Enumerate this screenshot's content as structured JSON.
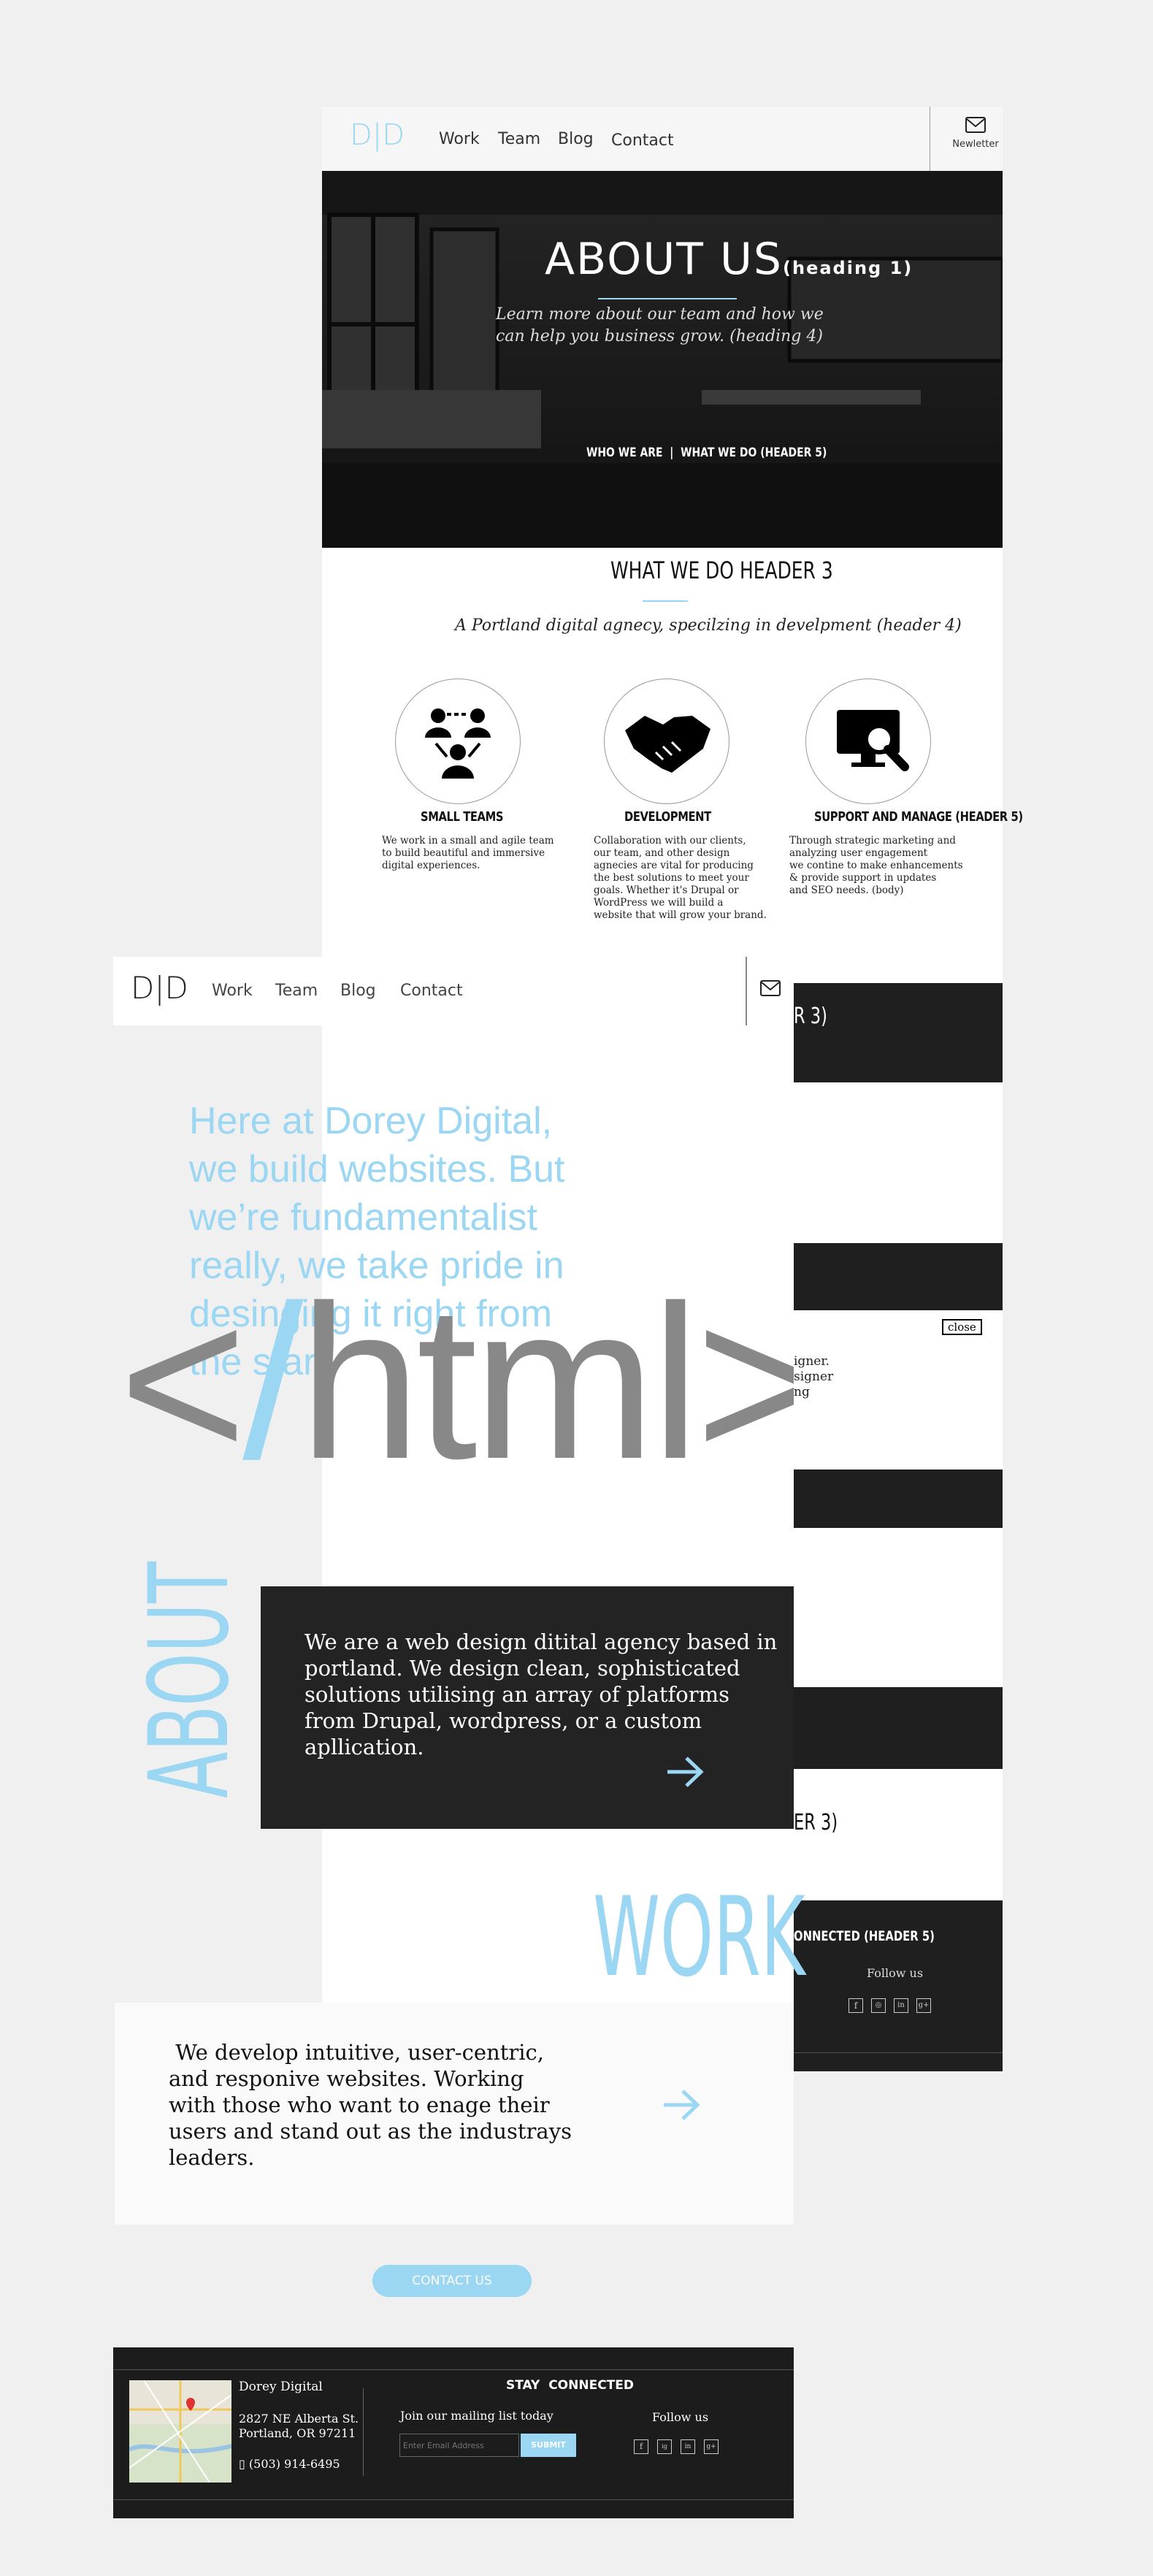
{
  "colors": {
    "accent": "#9bd6f2",
    "dark": "#222222",
    "page": "#f0f0f0"
  },
  "back": {
    "logo": "D|D",
    "nav": [
      "Work",
      "Team",
      "Blog",
      "Contact"
    ],
    "newsletter_label": "Newletter",
    "hero": {
      "title": "ABOUT US",
      "title_suffix": "(heading 1)",
      "subtitle_line1": "Learn more about our team and how we",
      "subtitle_line2": "can help you business grow. (heading 4)",
      "link_who": "WHO WE ARE",
      "link_sep": "|",
      "link_what": "WHAT WE DO (HEADER 5)"
    },
    "what_we_do": {
      "title": "WHAT WE DO HEADER 3",
      "subtitle": "A Portland digital agnecy, specilzing in develpment (header 4)"
    },
    "services": [
      {
        "icon": "team-icon",
        "title": "SMALL TEAMS",
        "body": "We work in a small and agile team\nto build beautiful and immersive\ndigital experiences."
      },
      {
        "icon": "handshake-icon",
        "title": "DEVELOPMENT",
        "body": "Collaboration with our clients,\nour team, and other design\nagnecies are vital for producing\n the best solutions to meet your\ngoals. Whether it's Drupal or\nWordPress we will build a\nwebsite that will grow your brand."
      },
      {
        "icon": "monitor-search-icon",
        "title": "SUPPORT AND MANAGE (HEADER 5)",
        "body": "Through strategic marketing and\n analyzing user engagement\nwe contine to make enhancements\n& provide support in updates\nand SEO needs. (body)"
      }
    ],
    "partial_heading_1": "R 3)",
    "close_label": "close",
    "partial_text": "igner.\nsigner\nng",
    "partial_heading_2": "ER 3)",
    "footer_partial": {
      "title": "ONNECTED (HEADER 5)",
      "follow": "Follow us"
    }
  },
  "front": {
    "logo": "D|D",
    "nav": [
      "Work",
      "Team",
      "Blog",
      "Contact"
    ],
    "intro": "Here at Dorey Digital, we build websites. But we’re fundamentalist really, we take pride in desinging it right from the start.",
    "html_tag": {
      "open": "<",
      "slash": "/",
      "word": "html",
      "close": ">"
    },
    "about_label": "ABOUT",
    "about_text": "We are a web design ditital agency based in portland. We design clean, sophisticated solutions utilising an array of platforms from Drupal, wordpress, or a custom apllication.",
    "work_label": "WORK",
    "work_text": " We develop intuitive, user-centric, and responive websites. Working with those who want to enage their users and stand out as the industrays leaders.",
    "contact_button": "CONTACT US",
    "footer": {
      "company": "Dorey Digital",
      "address_line1": "2827 NE Alberta St.",
      "address_line2": "Portland, OR 97211",
      "phone": "(503) 914-6495",
      "stay_connected": "STAY  CONNECTED",
      "mailing": "Join our mailing list today",
      "email_placeholder": "Enter Email Address",
      "submit": "SUBMIT",
      "follow": "Follow us",
      "social": [
        "f",
        "ig",
        "in",
        "g+"
      ]
    }
  }
}
